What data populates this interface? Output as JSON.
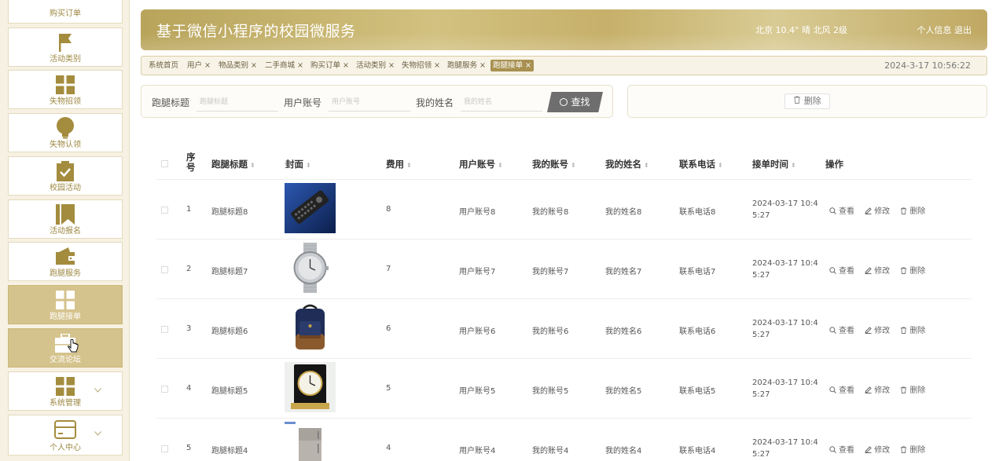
{
  "sidebar": {
    "top_partial_label": "购买订单",
    "items": [
      {
        "label": "活动类别",
        "icon": "flag-icon"
      },
      {
        "label": "失物招领",
        "icon": "grid-icon"
      },
      {
        "label": "失物认领",
        "icon": "bulb-icon"
      },
      {
        "label": "校园活动",
        "icon": "clipboard-check-icon"
      },
      {
        "label": "活动报名",
        "icon": "bookmark-icon"
      },
      {
        "label": "跑腿服务",
        "icon": "wallet-icon"
      },
      {
        "label": "跑腿接单",
        "icon": "grid-icon",
        "active": true
      },
      {
        "label": "交流论坛",
        "icon": "briefcase-icon",
        "active": true
      },
      {
        "label": "系统管理",
        "icon": "grid-icon",
        "expandable": true
      },
      {
        "label": "个人中心",
        "icon": "card-icon",
        "expandable": true
      }
    ]
  },
  "header": {
    "title": "基于微信小程序的校园微服务",
    "weather": "北京  10.4°  晴  北风  2级",
    "profile_link": "个人信息",
    "logout_link": "退出"
  },
  "tabs": [
    {
      "label": "系统首页"
    },
    {
      "label": "用户 ×"
    },
    {
      "label": "物品类别 ×"
    },
    {
      "label": "二手商城 ×"
    },
    {
      "label": "购买订单 ×"
    },
    {
      "label": "活动类别 ×"
    },
    {
      "label": "失物招领 ×"
    },
    {
      "label": "跑腿服务 ×"
    },
    {
      "label": "跑腿接单 ×",
      "active": true
    }
  ],
  "datetime": "2024-3-17 10:56:22",
  "search": {
    "fields": [
      {
        "label": "跑腿标题",
        "placeholder": "跑腿标题"
      },
      {
        "label": "用户账号",
        "placeholder": "用户账号"
      },
      {
        "label": "我的姓名",
        "placeholder": "我的姓名"
      }
    ],
    "button": "查找"
  },
  "toolbar": {
    "delete_label": "删除"
  },
  "table": {
    "headers": {
      "seq_line1": "序",
      "seq_line2": "号",
      "title": "跑腿标题",
      "cover": "封面",
      "fee": "费用",
      "user_account": "用户账号",
      "my_account": "我的账号",
      "my_name": "我的姓名",
      "phone": "联系电话",
      "time": "接单时间",
      "ops": "操作"
    },
    "sort_icon": "⬍",
    "rows": [
      {
        "seq": "1",
        "title": "跑腿标题8",
        "cover": "remote-control-image",
        "fee": "8",
        "user_account": "用户账号8",
        "my_account": "我的账号8",
        "my_name": "我的姓名8",
        "phone": "联系电话8",
        "time_line1": "2024-03-17 10:4",
        "time_line2": "5:27"
      },
      {
        "seq": "2",
        "title": "跑腿标题7",
        "cover": "watch-image",
        "fee": "7",
        "user_account": "用户账号7",
        "my_account": "我的账号7",
        "my_name": "我的姓名7",
        "phone": "联系电话7",
        "time_line1": "2024-03-17 10:4",
        "time_line2": "5:27"
      },
      {
        "seq": "3",
        "title": "跑腿标题6",
        "cover": "backpack-image",
        "fee": "6",
        "user_account": "用户账号6",
        "my_account": "我的账号6",
        "my_name": "我的姓名6",
        "phone": "联系电话6",
        "time_line1": "2024-03-17 10:4",
        "time_line2": "5:27"
      },
      {
        "seq": "4",
        "title": "跑腿标题5",
        "cover": "clock-image",
        "fee": "5",
        "user_account": "用户账号5",
        "my_account": "我的账号5",
        "my_name": "我的姓名5",
        "phone": "联系电话5",
        "time_line1": "2024-03-17 10:4",
        "time_line2": "5:27"
      },
      {
        "seq": "5",
        "title": "跑腿标题4",
        "cover": "fridge-image",
        "fee": "4",
        "user_account": "用户账号4",
        "my_account": "我的账号4",
        "my_name": "我的姓名4",
        "phone": "联系电话4",
        "time_line1": "2024-03-17 10:4",
        "time_line2": "5:27"
      }
    ],
    "ops": {
      "view": "查看",
      "edit": "修改",
      "delete": "删除"
    }
  },
  "colors": {
    "accent": "#d5c38d",
    "brand": "#c6b06a",
    "button_dark": "#6e6e6e"
  }
}
